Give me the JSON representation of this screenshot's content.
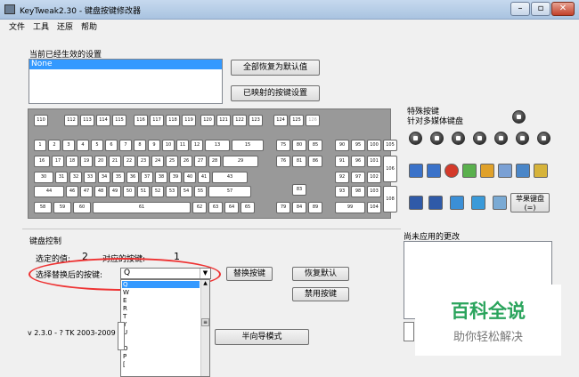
{
  "window": {
    "title": "KeyTweak2.30 -  键盘按键修改器",
    "minimize": "–",
    "maximize": "▫",
    "close": "✕"
  },
  "menu": [
    "文件",
    "工具",
    "还原",
    "帮助"
  ],
  "current_settings": {
    "label": "当前已经生效的设置",
    "selected_item": "None"
  },
  "buttons": {
    "restore_all": "全部恢复为默认值",
    "show_mapped": "已映射的按键设置",
    "replace_key": "替换按键",
    "restore_default": "恢复默认",
    "disable_key": "禁用按键",
    "wizard": "半向导模式",
    "apple_keyboard": "苹果键盘 (=)"
  },
  "special": {
    "title": "特殊按键",
    "subtitle": "针对多媒体键盘"
  },
  "keyboard": {
    "fkeys": [
      "110",
      "112",
      "113",
      "114",
      "115",
      "116",
      "117",
      "118",
      "119",
      "120",
      "121",
      "122",
      "123",
      "124",
      "125",
      "126"
    ],
    "row1": [
      "1",
      "2",
      "3",
      "4",
      "5",
      "6",
      "7",
      "8",
      "9",
      "10",
      "11",
      "12",
      "13",
      "15",
      "75",
      "80",
      "85",
      "90",
      "95",
      "100",
      "105"
    ],
    "row2": [
      "16",
      "17",
      "18",
      "19",
      "20",
      "21",
      "22",
      "23",
      "24",
      "25",
      "26",
      "27",
      "28",
      "29",
      "76",
      "81",
      "86",
      "91",
      "96",
      "101",
      "106"
    ],
    "row3": [
      "30",
      "31",
      "32",
      "33",
      "34",
      "35",
      "36",
      "37",
      "38",
      "39",
      "40",
      "41",
      "43",
      "92",
      "97",
      "102"
    ],
    "row4": [
      "44",
      "46",
      "47",
      "48",
      "49",
      "50",
      "51",
      "52",
      "53",
      "54",
      "55",
      "57",
      "83",
      "93",
      "98",
      "103",
      "108"
    ],
    "row5": [
      "58",
      "59",
      "60",
      "61",
      "62",
      "63",
      "64",
      "65",
      "79",
      "84",
      "89",
      "99",
      "104"
    ]
  },
  "control": {
    "group_label": "键盘控制",
    "selected_label": "选定的值:",
    "selected_value": "2",
    "mapped_label": "对应的按键:",
    "mapped_value": "1",
    "choose_label": "选择替换后的按键:",
    "combo_value": "Q",
    "combo_arrow": "▼"
  },
  "dropdown": {
    "items": [
      "Q",
      "W",
      "E",
      "R",
      "T",
      "Y",
      "U",
      "I",
      "O",
      "P",
      "["
    ],
    "scroll_up": "▲",
    "scroll_thumb": "≡"
  },
  "pending": {
    "label": "尚未应用的更改"
  },
  "version": "v 2.3.0 - ? TK 2003-2009",
  "watermark": {
    "title": "百科全说",
    "subtitle": "助你轻松解决"
  },
  "colors": {
    "selection": "#3399ff",
    "highlight_ellipse": "#e33333",
    "watermark_green": "#2aa45c"
  }
}
